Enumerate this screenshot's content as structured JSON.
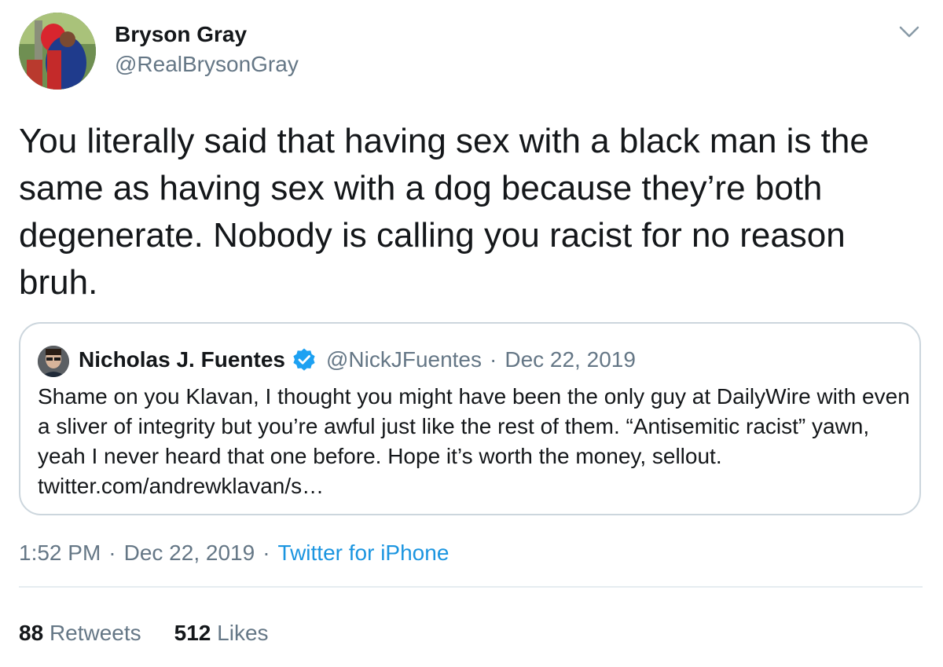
{
  "tweet": {
    "author": {
      "name": "Bryson Gray",
      "handle": "@RealBrysonGray"
    },
    "text": "You literally said that having sex with a black man is the same as having sex with a dog because they’re both degenerate. Nobody is calling you racist for no reason bruh.",
    "quoted": {
      "name": "Nicholas J. Fuentes",
      "handle": "@NickJFuentes",
      "separator": "·",
      "date": "Dec 22, 2019",
      "text": "Shame on you Klavan, I thought you might have been the only guy at DailyWire with even a sliver of integrity but you’re awful just like the rest of them. “Antisemitic racist” yawn, yeah I never heard that one before. Hope it’s worth the money, sellout. twitter.com/andrewklavan/s…"
    },
    "meta": {
      "time": "1:52 PM",
      "separator": "·",
      "date": "Dec 22, 2019",
      "source": "Twitter for iPhone"
    },
    "stats": {
      "retweets_count": "88",
      "retweets_label": "Retweets",
      "likes_count": "512",
      "likes_label": "Likes"
    }
  },
  "icons": {
    "caret": "chevron-down-icon",
    "verified": "verified-badge-icon"
  },
  "colors": {
    "text": "#14171a",
    "secondary": "#657786",
    "link": "#1b95e0",
    "verified": "#1da1f2",
    "border": "#ccd6dd"
  }
}
